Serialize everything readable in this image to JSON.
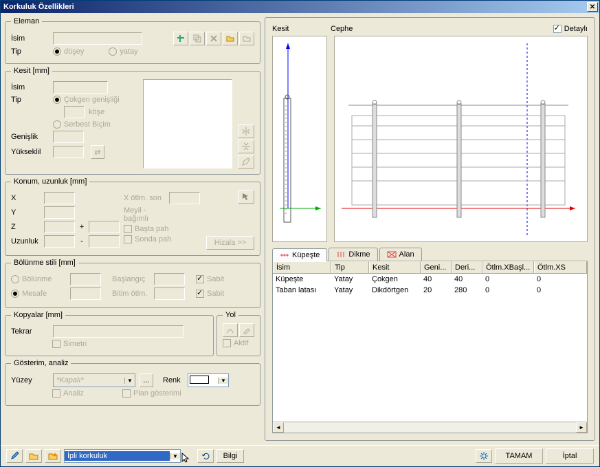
{
  "title": "Korkuluk Özellikleri",
  "eleman": {
    "legend": "Eleman",
    "isim_lbl": "İsim",
    "tip_lbl": "Tip",
    "radio_dusey": "düşey",
    "radio_yatay": "yatay"
  },
  "kesit": {
    "legend": "Kesit  [mm]",
    "isim_lbl": "İsim",
    "tip_lbl": "Tip",
    "cokgen": "Çokgen genişliği",
    "kose": "köşe",
    "serbest": "Serbest Biçim",
    "genislik_lbl": "Genişlik",
    "yukseklik_lbl": "Yükseklil"
  },
  "konum": {
    "legend": "Konum, uzunluk [mm]",
    "x_lbl": "X",
    "y_lbl": "Y",
    "z_lbl": "Z",
    "uzunluk_lbl": "Uzunluk",
    "xotlm_lbl": "X ötlm. son",
    "meyil_lbl": "Meyil - bağımlı",
    "basta_pah": "Başta pah",
    "sonda_pah": "Sonda pah",
    "hizala": "Hizala >>",
    "plus": "+",
    "minus": "-"
  },
  "bolunme": {
    "legend": "Bölünme stili [mm]",
    "bolunme": "Bölünme",
    "mesafe": "Mesafe",
    "baslangic": "Başlangıç",
    "bitim": "Bitim ötlm.",
    "sabit": "Sabit"
  },
  "kopyalar": {
    "legend": "Kopyalar [mm]",
    "tekrar_lbl": "Tekrar",
    "simetri": "Simetri"
  },
  "yol": {
    "legend": "Yol",
    "aktif": "Aktif"
  },
  "gosterim": {
    "legend": "Gösterim, analiz",
    "yuzey_lbl": "Yüzey",
    "yuzey_val": "*Kapalı*",
    "renk_lbl": "Renk",
    "analiz": "Analiz",
    "plan": "Plan gösterimi",
    "ellipsis": "..."
  },
  "preview": {
    "kesit_lbl": "Kesit",
    "cephe_lbl": "Cephe",
    "detayli": "Detaylı"
  },
  "tabs": {
    "t1": "Küpeşte",
    "t2": "Dikme",
    "t3": "Alan"
  },
  "table": {
    "h1": "İsim",
    "h2": "Tip",
    "h3": "Kesit",
    "h4": "Geni...",
    "h5": "Deri...",
    "h6": "Ötlm.XBaşl...",
    "h7": "Ötlm.XS",
    "rows": [
      {
        "isim": "Küpeşte",
        "tip": "Yatay",
        "kesit": "Çokgen",
        "gen": "40",
        "der": "40",
        "xb": "0",
        "xs": "0"
      },
      {
        "isim": "Taban latası",
        "tip": "Yatay",
        "kesit": "Dikdörtgen",
        "gen": "20",
        "der": "280",
        "xb": "0",
        "xs": "0"
      }
    ]
  },
  "bottom": {
    "combo": "İpli korkuluk",
    "bilgi": "Bilgi",
    "tamam": "TAMAM",
    "iptal": "İptal"
  }
}
